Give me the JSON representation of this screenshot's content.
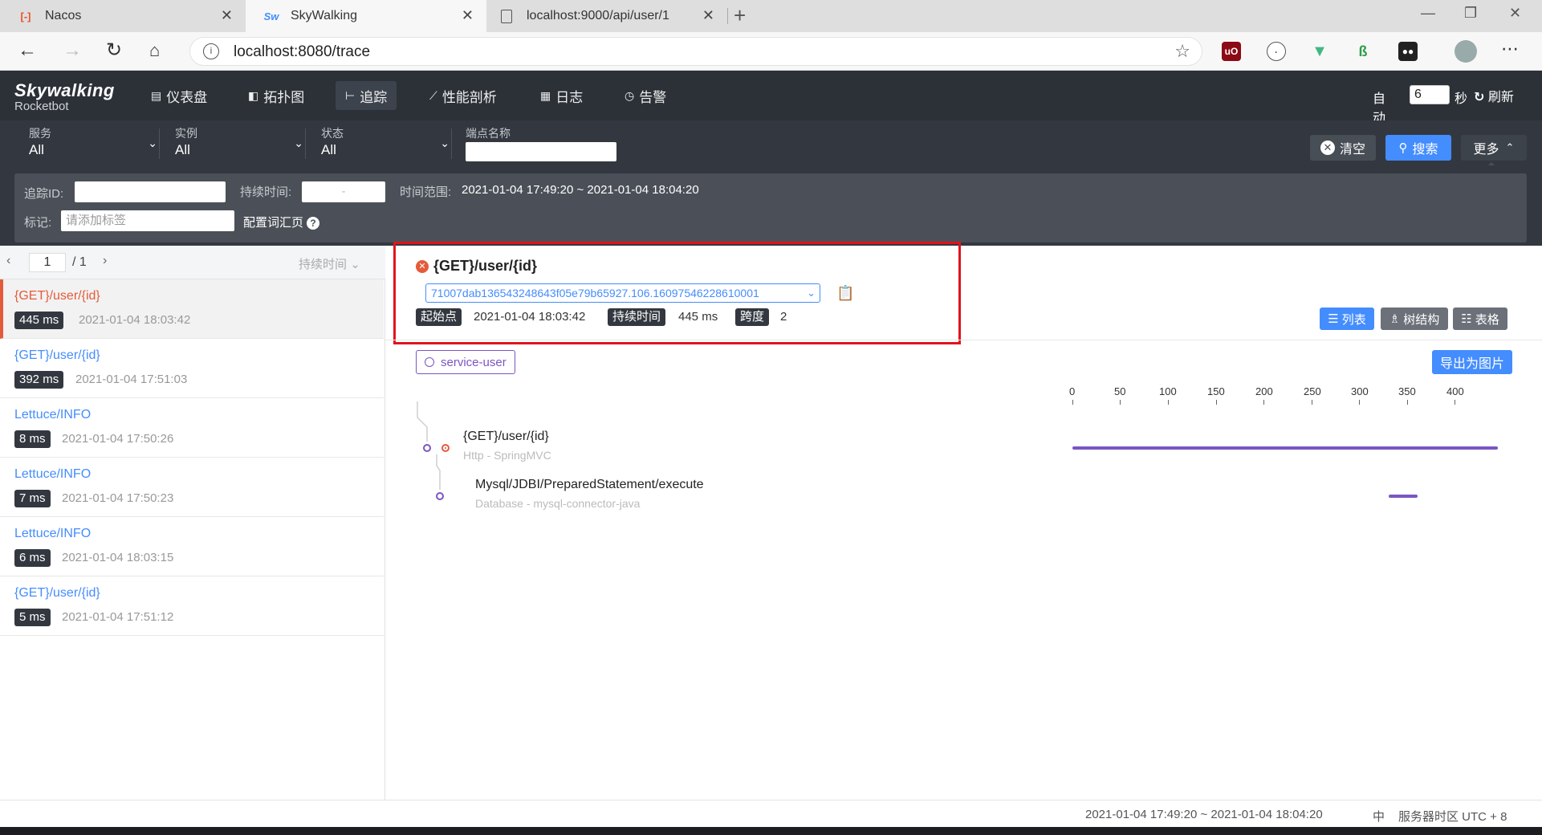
{
  "browser": {
    "tabs": [
      {
        "title": "Nacos",
        "icon": "nacos-icon"
      },
      {
        "title": "SkyWalking",
        "icon": "skywalking-icon"
      },
      {
        "title": "localhost:9000/api/user/1",
        "icon": "page-icon"
      }
    ],
    "url": "localhost:8080/trace"
  },
  "app": {
    "logo_main": "Skywalking",
    "logo_sub": "Rocketbot",
    "nav": [
      {
        "label": "仪表盘",
        "icon": "dashboard-icon"
      },
      {
        "label": "拓扑图",
        "icon": "topology-icon"
      },
      {
        "label": "追踪",
        "icon": "trace-icon"
      },
      {
        "label": "性能剖析",
        "icon": "profile-icon"
      },
      {
        "label": "日志",
        "icon": "log-icon"
      },
      {
        "label": "告警",
        "icon": "alarm-icon"
      }
    ],
    "auto_label": "自动",
    "interval": "6",
    "seconds_label": "秒",
    "refresh_label": "刷新"
  },
  "filters": {
    "service": {
      "label": "服务",
      "value": "All"
    },
    "instance": {
      "label": "实例",
      "value": "All"
    },
    "status": {
      "label": "状态",
      "value": "All"
    },
    "endpoint_label": "端点名称",
    "clear_label": "清空",
    "search_label": "搜索",
    "more_label": "更多"
  },
  "advanced": {
    "trace_id_label": "追踪ID:",
    "duration_label": "持续时间:",
    "duration_sep": "-",
    "time_range_label": "时间范围:",
    "time_range": "2021-01-04 17:49:20 ~ 2021-01-04 18:04:20",
    "tag_label": "标记:",
    "tag_placeholder": "请添加标签",
    "config_label": "配置词汇页"
  },
  "list": {
    "page": "1",
    "total": "/ 1",
    "sort_label": "持续时间",
    "items": [
      {
        "name": "{GET}/user/{id}",
        "duration": "445 ms",
        "time": "2021-01-04 18:03:42"
      },
      {
        "name": "{GET}/user/{id}",
        "duration": "392 ms",
        "time": "2021-01-04 17:51:03"
      },
      {
        "name": "Lettuce/INFO",
        "duration": "8 ms",
        "time": "2021-01-04 17:50:26"
      },
      {
        "name": "Lettuce/INFO",
        "duration": "7 ms",
        "time": "2021-01-04 17:50:23"
      },
      {
        "name": "Lettuce/INFO",
        "duration": "6 ms",
        "time": "2021-01-04 18:03:15"
      },
      {
        "name": "{GET}/user/{id}",
        "duration": "5 ms",
        "time": "2021-01-04 17:51:12"
      }
    ]
  },
  "detail": {
    "title": "{GET}/user/{id}",
    "trace_id": "71007dab136543248643f05e79b65927.106.16097546228610001",
    "start_label": "起始点",
    "start": "2021-01-04 18:03:42",
    "duration_label": "持续时间",
    "duration": "445 ms",
    "span_label": "跨度",
    "spans_count": "2",
    "view_list": "列表",
    "view_tree": "树结构",
    "view_table": "表格",
    "service": "service-user",
    "export_label": "导出为图片",
    "scale": [
      "0",
      "50",
      "100",
      "150",
      "200",
      "250",
      "300",
      "350",
      "400"
    ],
    "spans": [
      {
        "name": "{GET}/user/{id}",
        "sub": "Http - SpringMVC"
      },
      {
        "name": "Mysql/JDBI/PreparedStatement/execute",
        "sub": "Database - mysql-connector-java"
      }
    ],
    "accent": "#7b55c3",
    "error_color": "#e45b3a"
  },
  "footer": {
    "time_range": "2021-01-04 17:49:20 ~ 2021-01-04 18:04:20",
    "lang": "中",
    "timezone": "服务器时区 UTC + 8"
  }
}
